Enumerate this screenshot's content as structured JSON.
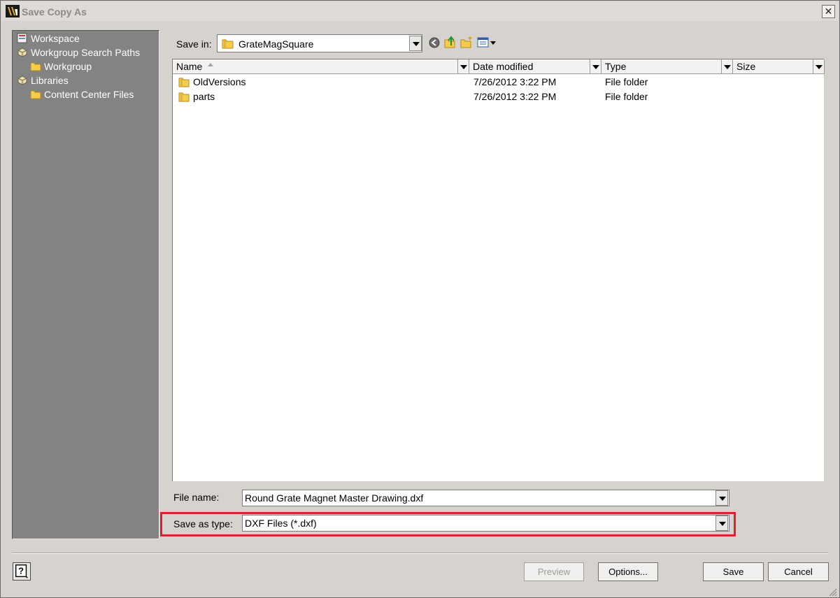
{
  "window": {
    "title": "Save Copy As",
    "close_glyph": "✕"
  },
  "places": [
    {
      "label": "Workspace",
      "icon": "workspace-icon"
    },
    {
      "label": "Workgroup Search Paths",
      "icon": "search-paths-icon"
    },
    {
      "label": "Workgroup",
      "icon": "folder-icon"
    },
    {
      "label": "Libraries",
      "icon": "libraries-icon"
    },
    {
      "label": "Content Center Files",
      "icon": "folder-icon"
    }
  ],
  "save_in": {
    "label": "Save in:",
    "value": "GrateMagSquare"
  },
  "toolbar": {
    "icons": [
      "back-icon",
      "up-folder-icon",
      "new-folder-icon",
      "view-menu-icon"
    ]
  },
  "file_list": {
    "columns": [
      "Name",
      "Date modified",
      "Type",
      "Size"
    ],
    "sort_column": "Name",
    "rows": [
      {
        "name": "OldVersions",
        "date": "7/26/2012 3:22 PM",
        "type": "File folder",
        "size": ""
      },
      {
        "name": "parts",
        "date": "7/26/2012 3:22 PM",
        "type": "File folder",
        "size": ""
      }
    ]
  },
  "file_name": {
    "label": "File name:",
    "value": "Round Grate Magnet Master Drawing.dxf"
  },
  "save_as_type": {
    "label": "Save as type:",
    "value": "DXF Files (*.dxf)"
  },
  "buttons": {
    "help": "?",
    "preview": "Preview",
    "options": "Options...",
    "save": "Save",
    "cancel": "Cancel"
  },
  "colors": {
    "highlight": "#e0202a",
    "places_bg": "#838383",
    "dialog_bg": "#d6d3ce"
  }
}
